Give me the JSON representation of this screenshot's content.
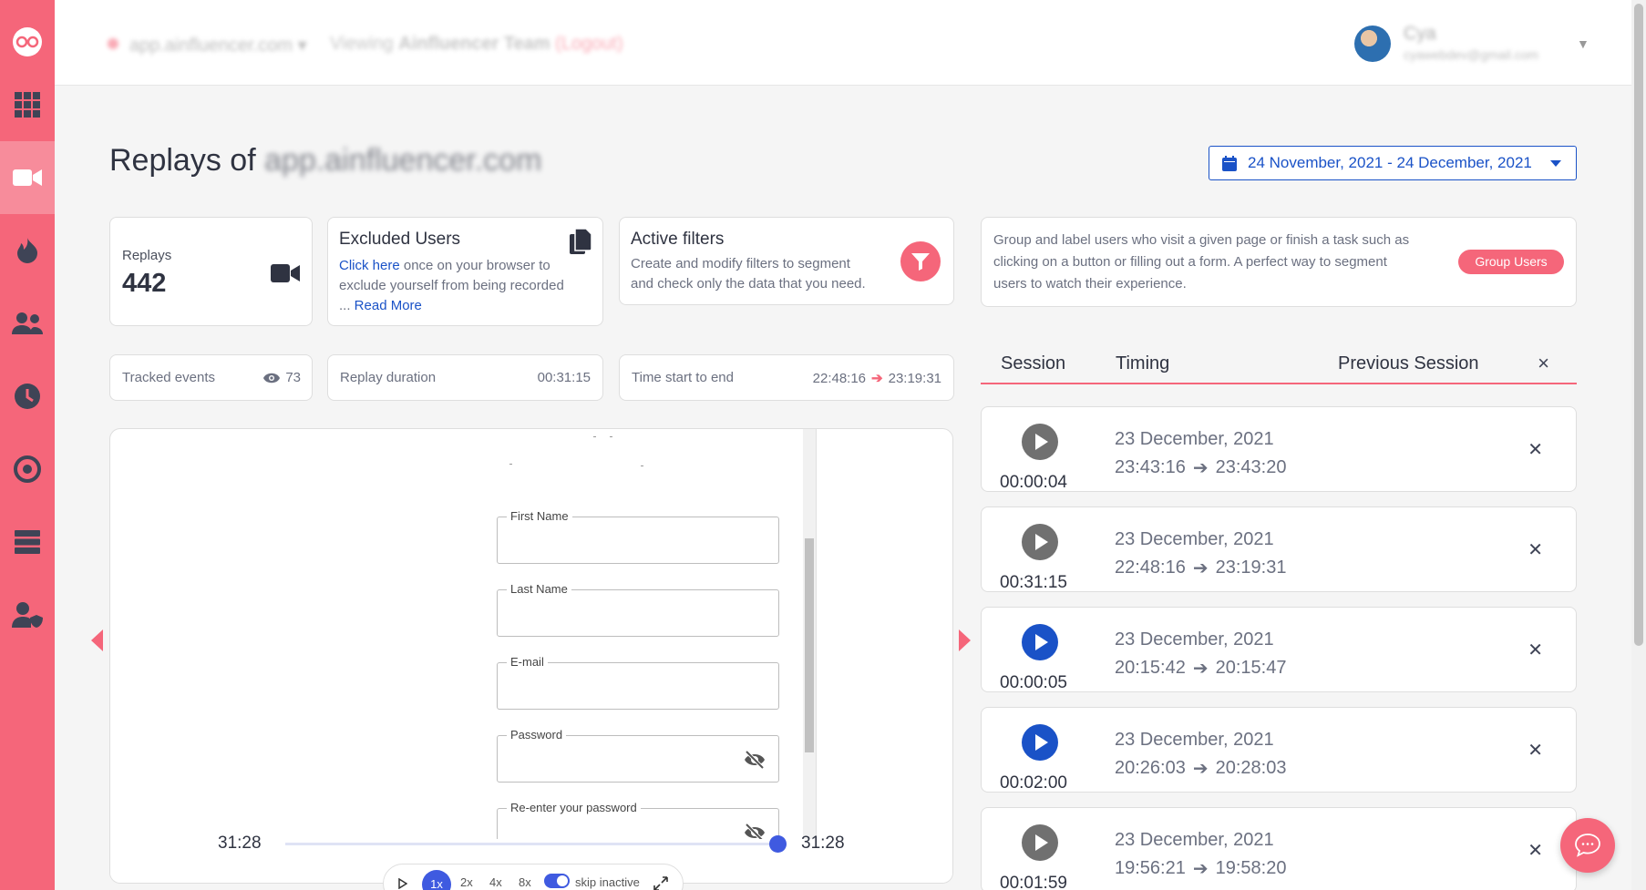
{
  "sidebar": {
    "items": [
      {
        "name": "logo"
      },
      {
        "name": "dashboard"
      },
      {
        "name": "replays",
        "active": true
      },
      {
        "name": "heatmaps"
      },
      {
        "name": "users"
      },
      {
        "name": "history"
      },
      {
        "name": "goals"
      },
      {
        "name": "data"
      },
      {
        "name": "privacy"
      }
    ]
  },
  "header": {
    "site_name": "app.ainfluencer.com",
    "viewing_label": "Viewing",
    "team_name": "Ainfluencer Team",
    "logout_label": "(Logout)",
    "user_name": "Cya",
    "user_email": "cyawebdev@gmail.com"
  },
  "page": {
    "title": "Replays of",
    "title_site": "app.ainfluencer.com",
    "date_range": "24 November, 2021 - 24 December, 2021"
  },
  "cards": {
    "replays_label": "Replays",
    "replays_count": "442",
    "excluded_title": "Excluded Users",
    "excluded_link": "Click here",
    "excluded_text_1": " once on your browser to",
    "excluded_text_2": "exclude yourself from being recorded",
    "excluded_text_3": "... ",
    "excluded_read_more": "Read More",
    "filters_title": "Active filters",
    "filters_text_1": "Create and modify filters to segment",
    "filters_text_2": "and check only the data that you need.",
    "group_text_1": "Group and label users who visit a given page or finish a task such as",
    "group_text_2": "clicking on a button or filling out a form. A perfect way to segment",
    "group_text_3": "users to watch their experience.",
    "group_button": "Group Users"
  },
  "stats": {
    "tracked_label": "Tracked events",
    "tracked_value": "73",
    "duration_label": "Replay duration",
    "duration_value": "00:31:15",
    "time_label": "Time start to end",
    "time_start": "22:48:16",
    "time_end": "23:19:31"
  },
  "session_tabs": {
    "session": "Session",
    "timing": "Timing",
    "previous": "Previous Session",
    "close": "×"
  },
  "sessions": [
    {
      "duration": "00:00:04",
      "date": "23 December, 2021",
      "start": "23:43:16",
      "end": "23:43:20",
      "active": false
    },
    {
      "duration": "00:31:15",
      "date": "23 December, 2021",
      "start": "22:48:16",
      "end": "23:19:31",
      "active": false
    },
    {
      "duration": "00:00:05",
      "date": "23 December, 2021",
      "start": "20:15:42",
      "end": "20:15:47",
      "active": true
    },
    {
      "duration": "00:02:00",
      "date": "23 December, 2021",
      "start": "20:26:03",
      "end": "20:28:03",
      "active": true
    },
    {
      "duration": "00:01:59",
      "date": "23 December, 2021",
      "start": "19:56:21",
      "end": "19:58:20",
      "active": false
    }
  ],
  "player": {
    "fields": [
      "First Name",
      "Last Name",
      "E-mail",
      "Password",
      "Re-enter your password"
    ],
    "time_current": "31:28",
    "time_total": "31:28",
    "progress": 1.0,
    "speeds": [
      "1x",
      "2x",
      "4x",
      "8x"
    ],
    "active_speed": "1x",
    "skip_inactive_label": "skip inactive",
    "skip_inactive": true
  },
  "colors": {
    "brand": "#f5667a",
    "accent": "#1a52c7",
    "player_accent": "#3f5ae0"
  }
}
